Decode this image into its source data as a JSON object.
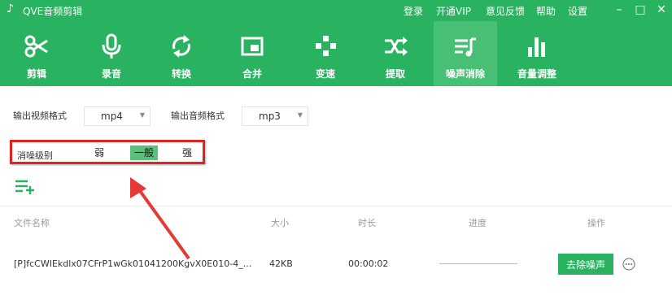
{
  "window": {
    "title": "QVE音频剪辑"
  },
  "menu": {
    "login": "登录",
    "vip": "开通VIP",
    "feedback": "意见反馈",
    "help": "帮助",
    "settings": "设置"
  },
  "window_controls": {
    "minimize": "–",
    "maximize": "□",
    "close": "✕"
  },
  "toolbar": {
    "items": [
      {
        "label": "剪辑",
        "icon": "scissors-icon"
      },
      {
        "label": "录音",
        "icon": "microphone-icon"
      },
      {
        "label": "转换",
        "icon": "convert-arrows-icon"
      },
      {
        "label": "合并",
        "icon": "merge-icon"
      },
      {
        "label": "变速",
        "icon": "speed-icon"
      },
      {
        "label": "提取",
        "icon": "extract-shuffle-icon"
      },
      {
        "label": "噪声消除",
        "icon": "noise-reduction-icon",
        "active": true
      },
      {
        "label": "音量调整",
        "icon": "volume-bars-icon"
      }
    ]
  },
  "output": {
    "video_label": "输出视频格式",
    "video_value": "mp4",
    "audio_label": "输出音频格式",
    "audio_value": "mp3"
  },
  "noise": {
    "label": "消噪级别",
    "levels": [
      "弱",
      "一般",
      "强"
    ],
    "selected": "一般"
  },
  "table": {
    "headers": {
      "name": "文件名称",
      "size": "大小",
      "duration": "时长",
      "progress": "进度",
      "action": "操作"
    },
    "rows": [
      {
        "name": "[P]fcCWIEkdlx07CFrP1wGk01041200KgvX0E010-4_...",
        "size": "42KB",
        "duration": "00:00:02",
        "progress": 0,
        "button": "去除噪声"
      }
    ]
  },
  "colors": {
    "brand_green": "#29b25f",
    "highlight_red": "#e02222",
    "selected_level": "#5cc07b"
  }
}
